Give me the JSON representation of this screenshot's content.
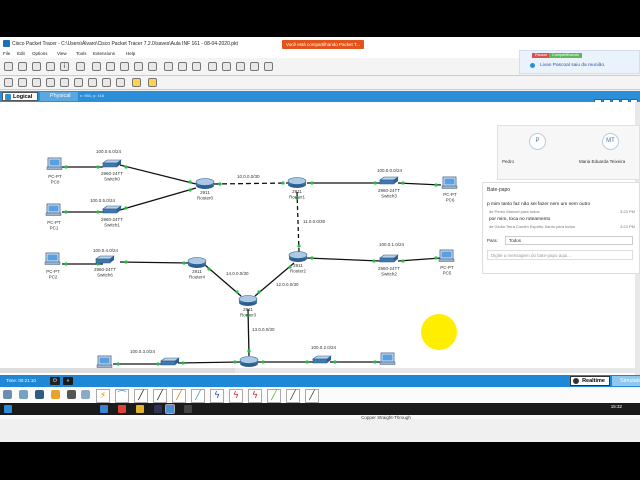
{
  "window": {
    "title": "Cisco Packet Tracer - C:\\Users\\Álvaro\\Cisco Packet Tracer 7.2.0\\saves\\Aula INF 161 - 08-04-2020.pkt",
    "share_banner": "Você está compartilhando Packet T..."
  },
  "menu": [
    "File",
    "Edit",
    "Options",
    "View",
    "Tools",
    "Extensions",
    "Help"
  ],
  "tabs": {
    "logical": "Logical",
    "physical": "Physical",
    "coords": "x: 960, y: 416"
  },
  "topology": {
    "devices": [
      {
        "id": "pc0",
        "label1": "PC-PT",
        "label2": "PC0"
      },
      {
        "id": "pc1",
        "label1": "PC-PT",
        "label2": "PC1"
      },
      {
        "id": "pc2",
        "label1": "PC-PT",
        "label2": "PC2"
      },
      {
        "id": "pc3",
        "label1": "PC-PT",
        "label2": "PC3"
      },
      {
        "id": "pc4",
        "label1": "PC-PT",
        "label2": "PC4"
      },
      {
        "id": "pc5",
        "label1": "PC-PT",
        "label2": "PC5"
      },
      {
        "id": "pc6",
        "label1": "PC-PT",
        "label2": "PC6"
      },
      {
        "id": "sw0",
        "label1": "2960-24TT",
        "label2": "Switch0"
      },
      {
        "id": "sw1",
        "label1": "2960-24TT",
        "label2": "Switch1"
      },
      {
        "id": "sw2",
        "label1": "2960-24TT",
        "label2": "Switch2"
      },
      {
        "id": "sw3",
        "label1": "2960-24TT",
        "label2": "Switch3"
      },
      {
        "id": "sw4",
        "label1": "2960-24TT",
        "label2": "Switch4"
      },
      {
        "id": "sw5",
        "label1": "2960-24TT",
        "label2": "Switch5"
      },
      {
        "id": "sw6",
        "label1": "2960-24TT",
        "label2": "Switch6"
      },
      {
        "id": "r0",
        "label1": "2911",
        "label2": "Router0"
      },
      {
        "id": "r1",
        "label1": "2911",
        "label2": "Router1"
      },
      {
        "id": "r2",
        "label1": "2911",
        "label2": "Router2"
      },
      {
        "id": "r3",
        "label1": "2911",
        "label2": "Router3"
      },
      {
        "id": "r4",
        "label1": "2911",
        "label2": "Router4"
      },
      {
        "id": "r5",
        "label1": "2911",
        "label2": "Router5"
      }
    ],
    "networks": [
      "100.0.6.0/24",
      "100.0.5.0/24",
      "10.0.0.0/30",
      "100.0.0.0/24",
      "11.0.0.0/30",
      "100.0.4.0/24",
      "100.0.1.0/24",
      "14.0.0.0/30",
      "12.0.0.0/30",
      "13.0.0.0/30",
      "100.0.3.0/24",
      "100.0.2.0/24"
    ]
  },
  "status": {
    "time": "Time: 00:21:10",
    "realtime": "Realtime",
    "simulation": "Simulation"
  },
  "connection_type": "Copper Straight-Through",
  "meeting": {
    "notification": "Livan Pascoal saiu da reunião.",
    "badge_pause": "Pausar",
    "badge_share": "Compartilhando",
    "participants": [
      {
        "initials": "P",
        "name": "Pedro"
      },
      {
        "initials": "MT",
        "name": "Maria Eduarda Teixeira"
      }
    ],
    "chat": {
      "title": "Bate-papo",
      "messages": [
        {
          "text": "p mim tanto faz não sei fazer nem um nem outro",
          "meta": "de Pedro Manoel para todos",
          "time": "3:23 PM"
        },
        {
          "text": "por mim, toca no roteamento",
          "meta": "de Giulia Terra Comim Espírito Santo para todos",
          "time": "3:23 PM"
        }
      ],
      "to_label": "Para:",
      "to_value": "Todos",
      "placeholder": "Digite a mensagem do bate-papo aqui..."
    }
  },
  "clock": {
    "time": "15:32",
    "date": "08/04/2020"
  }
}
